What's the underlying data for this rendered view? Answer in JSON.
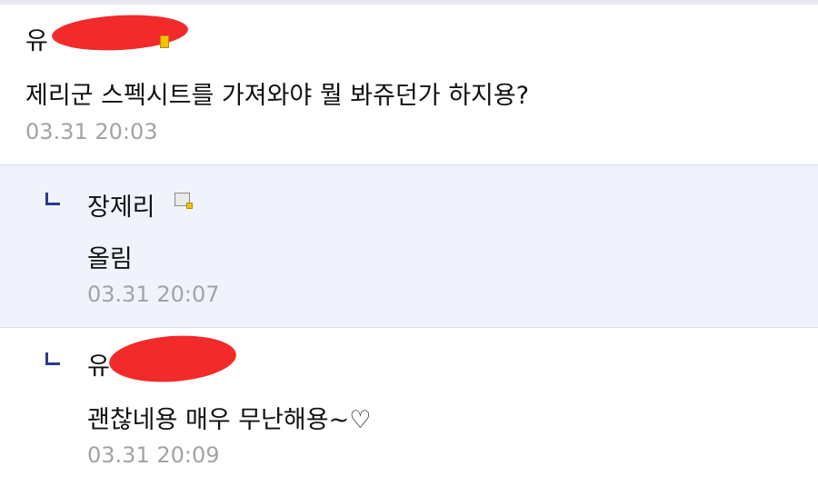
{
  "comments": [
    {
      "author": "유",
      "text": "제리군 스펙시트를 가져와야 뭘 봐쥬던가 하지용?",
      "time": "03.31 20:03",
      "author_redacted": true
    },
    {
      "author": "장제리",
      "text": "올림",
      "time": "03.31 20:07",
      "is_reply": true,
      "author_redacted": false,
      "badge_icon": "member-level-icon"
    },
    {
      "author": "유",
      "text": "괜찮네용 매우 무난해용~♡",
      "time": "03.31 20:09",
      "is_reply": true,
      "author_redacted": true
    }
  ],
  "colors": {
    "reply_background": "#f0f3fb",
    "reply_arrow": "#2c3a8c",
    "timestamp": "#a3a3a3",
    "redaction": "#f22a2a"
  }
}
